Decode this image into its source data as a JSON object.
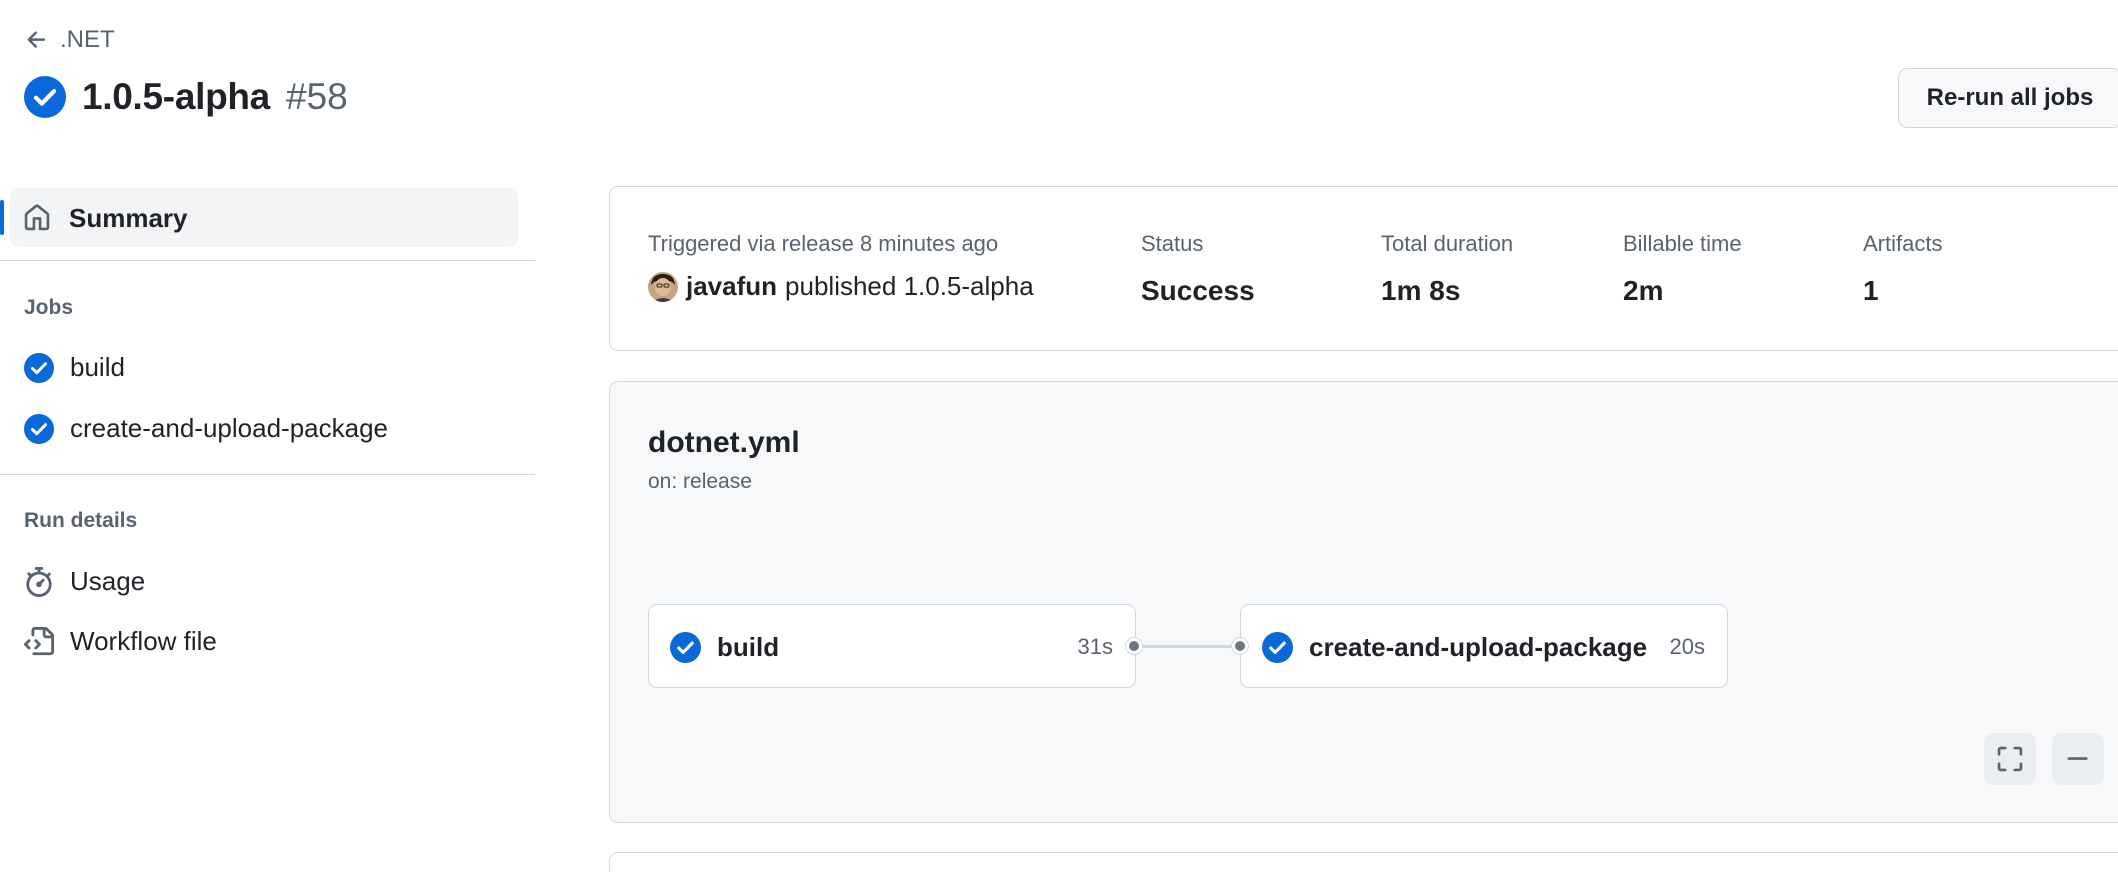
{
  "header": {
    "back_label": ".NET",
    "run_title": "1.0.5-alpha",
    "run_number": "#58",
    "rerun_label": "Re-run all jobs"
  },
  "sidebar": {
    "summary_label": "Summary",
    "jobs_heading": "Jobs",
    "jobs": [
      {
        "label": "build",
        "icon": "check-circle-fill-icon"
      },
      {
        "label": "create-and-upload-package",
        "icon": "check-circle-fill-icon"
      }
    ],
    "run_details_heading": "Run details",
    "details": [
      {
        "label": "Usage",
        "icon": "stopwatch-icon"
      },
      {
        "label": "Workflow file",
        "icon": "file-code-icon"
      }
    ]
  },
  "summary": {
    "trigger_label": "Triggered via release 8 minutes ago",
    "actor": "javafun",
    "action_text": "published 1.0.5-alpha",
    "status_label": "Status",
    "status_value": "Success",
    "duration_label": "Total duration",
    "duration_value": "1m 8s",
    "billable_label": "Billable time",
    "billable_value": "2m",
    "artifacts_label": "Artifacts",
    "artifacts_value": "1"
  },
  "workflow": {
    "file_name": "dotnet.yml",
    "trigger": "on: release",
    "jobs": [
      {
        "name": "build",
        "duration": "31s",
        "status": "success"
      },
      {
        "name": "create-and-upload-package",
        "duration": "20s",
        "status": "success"
      }
    ]
  },
  "colors": {
    "success": "#0969da",
    "border": "#d1d9e0",
    "muted_text": "#59636e",
    "graph_bg": "#f6f8fa"
  }
}
